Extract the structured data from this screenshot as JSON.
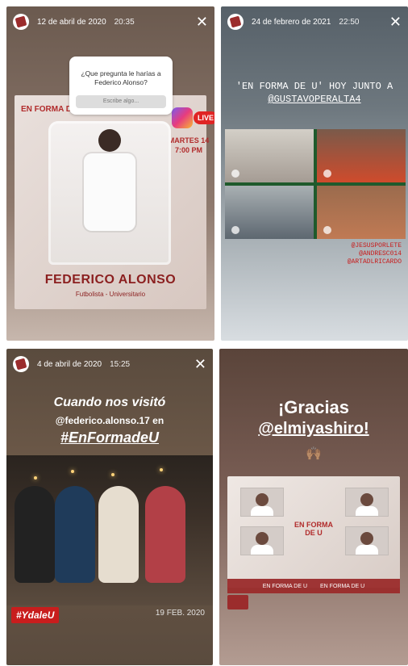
{
  "stories": [
    {
      "date": "12 de abril de 2020",
      "time": "20:35",
      "question_prompt": "¿Que pregunta le harías a Federico Alonso?",
      "input_placeholder": "Escribe algo...",
      "brand_text": "EN FORMA DE U",
      "live_label": "LIVE",
      "schedule_line1": "MARTES 14",
      "schedule_line2": "7:00 PM",
      "player_name": "FEDERICO ALONSO",
      "player_subtitle": "Futbolista - Universitario"
    },
    {
      "date": "24 de febrero de 2021",
      "time": "22:50",
      "title_line": "'EN FORMA DE U' HOY JUNTO A",
      "title_handle": "@GUSTAVOPERALTA4",
      "tags": [
        "@JESUSPORLETE",
        "@ANDRESC014",
        "@ARTADLRICARDO"
      ]
    },
    {
      "date": "4 de abril de 2020",
      "time": "15:25",
      "headline": "Cuando nos visitó",
      "handle_line": "@federico.alonso.17 en",
      "hashtag": "#EnFormadeU",
      "badge": "#YdaleU",
      "photo_date": "19 FEB. 2020"
    },
    {
      "title": "¡Gracias",
      "handle": "@elmiyashiro!",
      "emoji": "🙌🏽",
      "center_brand": "EN FORMA DE U",
      "footer_items": [
        "EN FORMA DE U",
        "EN FORMA DE U"
      ]
    }
  ],
  "icons": {
    "close": "close-icon",
    "avatar": "team-avatar",
    "instagram": "instagram-icon"
  }
}
